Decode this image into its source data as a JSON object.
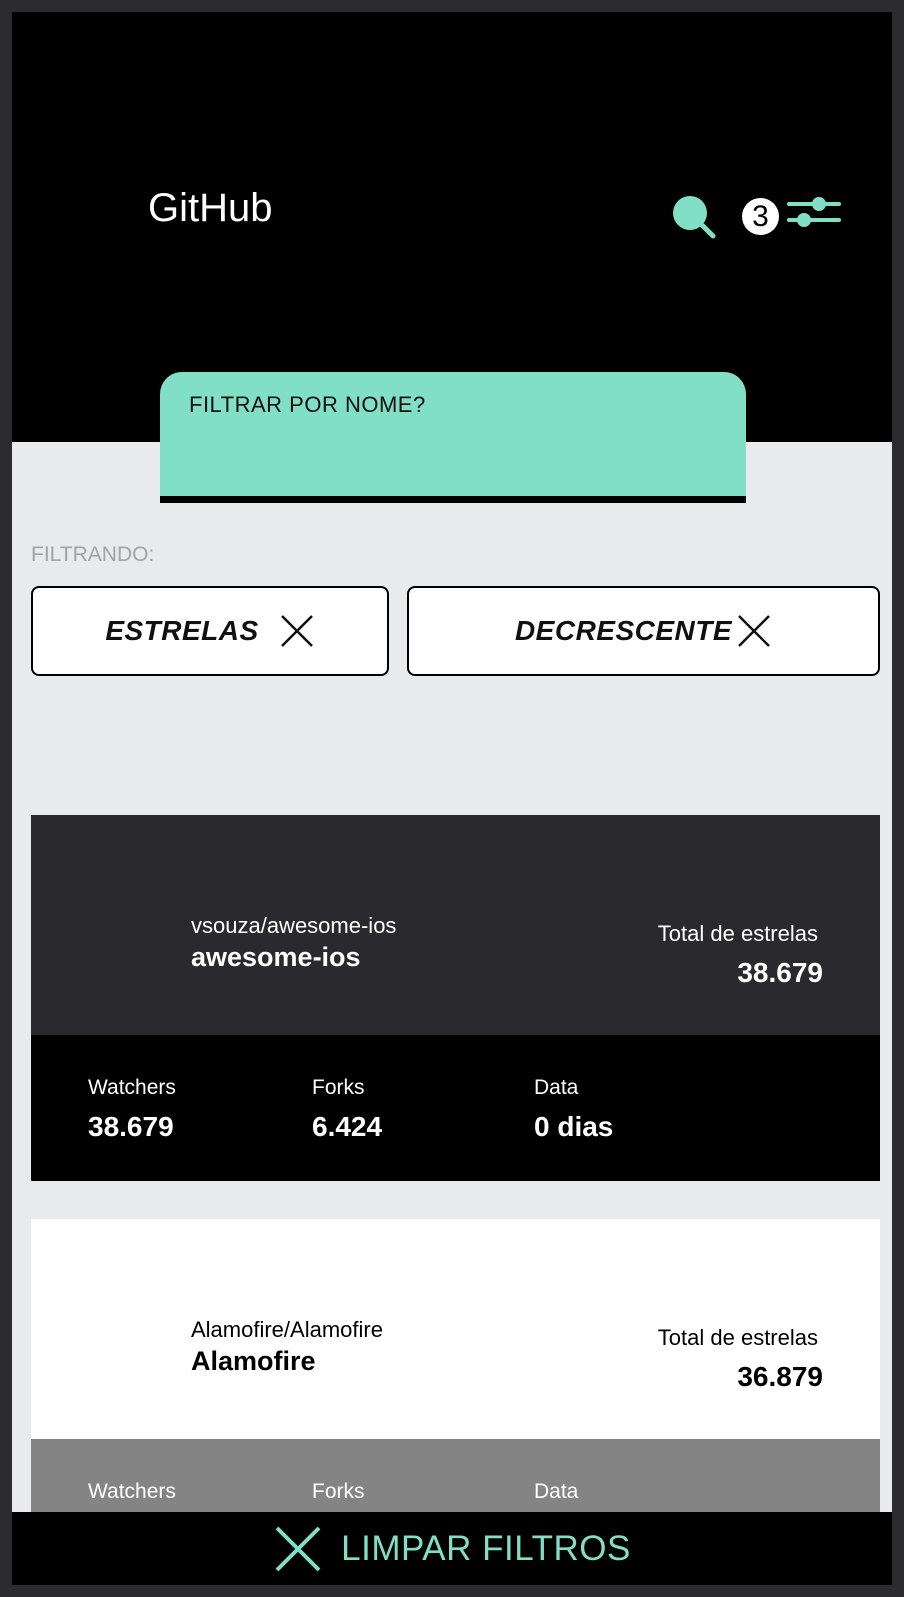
{
  "header": {
    "title": "GitHub",
    "search_icon": "search-icon",
    "filter_count": "3",
    "filter_icon": "sliders-icon",
    "accent_color": "#80dfc4"
  },
  "search": {
    "label": "FILTRAR POR NOME?",
    "value": ""
  },
  "filters": {
    "label": "FILTRANDO:",
    "chips": [
      {
        "label": "ESTRELAS",
        "icon": "close-icon"
      },
      {
        "label": "DECRESCENTE",
        "icon": "close-icon"
      }
    ]
  },
  "repos": [
    {
      "full_name": "vsouza/awesome-ios",
      "name": "awesome-ios",
      "stars_label": "Total de estrelas",
      "stars": "38.679",
      "watchers_label": "Watchers",
      "watchers": "38.679",
      "forks_label": "Forks",
      "forks": "6.424",
      "date_label": "Data",
      "date": "0 dias"
    },
    {
      "full_name": "Alamofire/Alamofire",
      "name": "Alamofire",
      "stars_label": "Total de estrelas",
      "stars": "36.879",
      "watchers_label": "Watchers",
      "forks_label": "Forks",
      "date_label": "Data"
    }
  ],
  "footer": {
    "clear_label": "LIMPAR FILTROS",
    "clear_icon": "close-icon"
  }
}
